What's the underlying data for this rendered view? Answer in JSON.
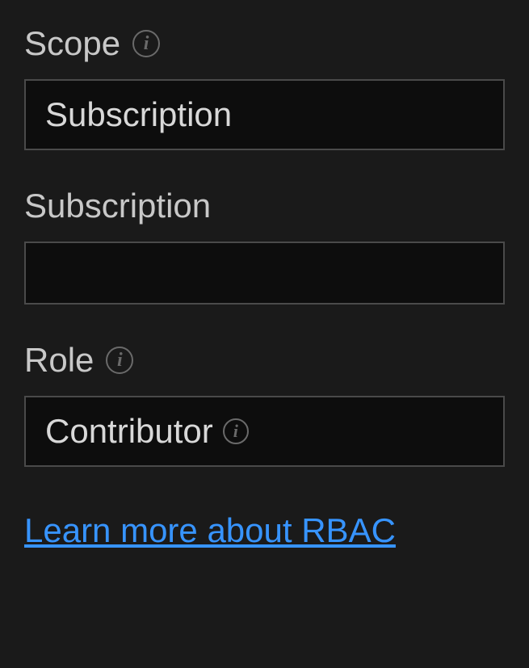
{
  "fields": {
    "scope": {
      "label": "Scope",
      "value": "Subscription",
      "has_info": true
    },
    "subscription": {
      "label": "Subscription",
      "value": "",
      "has_info": false
    },
    "role": {
      "label": "Role",
      "value": "Contributor",
      "has_info": true,
      "value_has_info": true
    }
  },
  "link": {
    "text": "Learn more about RBAC"
  }
}
